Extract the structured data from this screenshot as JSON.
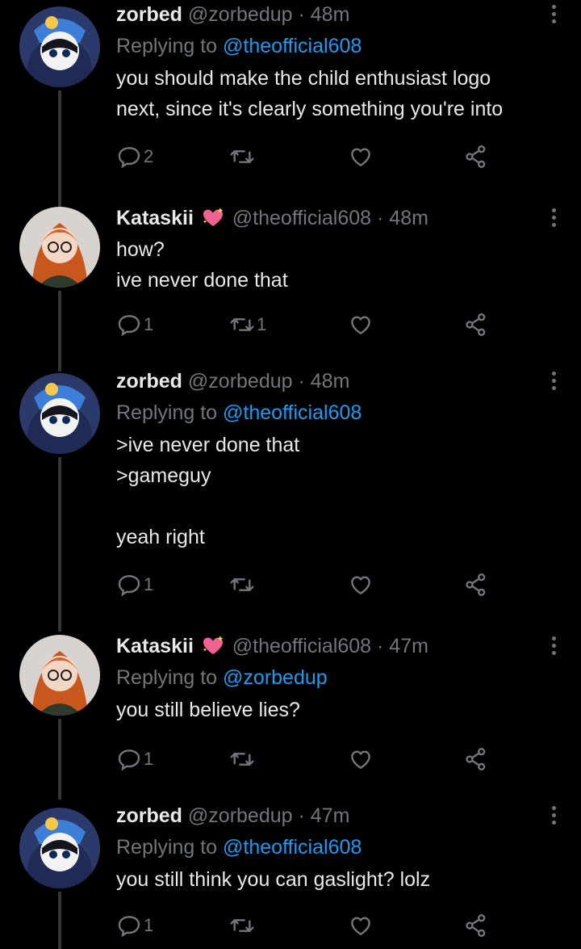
{
  "colors": {
    "background": "#000000",
    "text": "#e7e9ea",
    "muted": "#71767b",
    "link": "#1d9bf0",
    "thread_line": "#333639"
  },
  "tweets": [
    {
      "name": "zorbed",
      "emoji": "",
      "handle": "@zorbedup",
      "time": "48m",
      "reply_label": "Replying to ",
      "reply_to": "@theofficial608",
      "text": "you should make the child enthusiast logo\nnext, since it's clearly something you're into",
      "replies": "2",
      "retweets": "",
      "likes": "",
      "avatar": "klonoa-avatar"
    },
    {
      "name": "Kataskii",
      "emoji": "sparkling-heart",
      "handle": "@theofficial608",
      "time": "48m",
      "reply_label": "",
      "reply_to": "",
      "text": "how?\nive never done that",
      "replies": "1",
      "retweets": "1",
      "likes": "",
      "avatar": "futaba-avatar"
    },
    {
      "name": "zorbed",
      "emoji": "",
      "handle": "@zorbedup",
      "time": "48m",
      "reply_label": "Replying to ",
      "reply_to": "@theofficial608",
      "text": ">ive never done that\n>gameguy\n\nyeah right",
      "replies": "1",
      "retweets": "",
      "likes": "",
      "avatar": "klonoa-avatar"
    },
    {
      "name": "Kataskii",
      "emoji": "sparkling-heart",
      "handle": "@theofficial608",
      "time": "47m",
      "reply_label": "Replying to ",
      "reply_to": "@zorbedup",
      "text": "you still believe lies?",
      "replies": "1",
      "retweets": "",
      "likes": "",
      "avatar": "futaba-avatar"
    },
    {
      "name": "zorbed",
      "emoji": "",
      "handle": "@zorbedup",
      "time": "47m",
      "reply_label": "Replying to ",
      "reply_to": "@theofficial608",
      "text": "you still think you can gaslight? lolz",
      "replies": "1",
      "retweets": "",
      "likes": "",
      "avatar": "klonoa-avatar"
    }
  ]
}
